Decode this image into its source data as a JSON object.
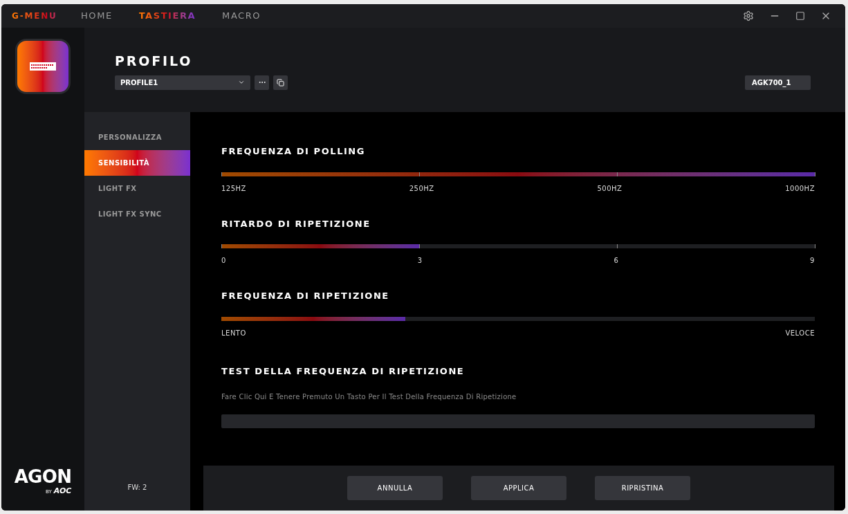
{
  "app_title": "G-MENU",
  "nav": [
    {
      "label": "HOME",
      "selected": false
    },
    {
      "label": "TASTIERA",
      "selected": true
    },
    {
      "label": "MACRO",
      "selected": false
    }
  ],
  "brand": {
    "name": "AGON",
    "by": "BY",
    "maker": "AOC"
  },
  "firmware": "FW: 2",
  "profile": {
    "title": "PROFILO",
    "selected_profile": "PROFILE1",
    "device": "AGK700_1"
  },
  "submenu": [
    {
      "label": "PERSONALIZZA",
      "selected": false
    },
    {
      "label": "SENSIBILITÀ",
      "selected": true
    },
    {
      "label": "LIGHT FX",
      "selected": false
    },
    {
      "label": "LIGHT FX SYNC",
      "selected": false
    }
  ],
  "sliders": [
    {
      "title": "FREQUENZA DI POLLING",
      "level": 1.0,
      "ticks": true,
      "labels": [
        "125HZ",
        "250HZ",
        "500HZ",
        "1000HZ"
      ]
    },
    {
      "title": "RITARDO DI RIPETIZIONE",
      "level": 0.3333,
      "ticks": true,
      "labels": [
        "0",
        "3",
        "6",
        "9"
      ]
    },
    {
      "title": "FREQUENZA DI RIPETIZIONE",
      "level": 0.31,
      "ticks": false,
      "labels": [
        "LENTO",
        "VELOCE"
      ]
    }
  ],
  "test": {
    "title": "TEST DELLA FREQUENZA DI RIPETIZIONE",
    "hint": "Fare Clic Qui E Tenere Premuto Un Tasto Per Il Test Della Frequenza Di Ripetizione"
  },
  "buttons": [
    "ANNULLA",
    "APPLICA",
    "RIPRISTINA"
  ]
}
